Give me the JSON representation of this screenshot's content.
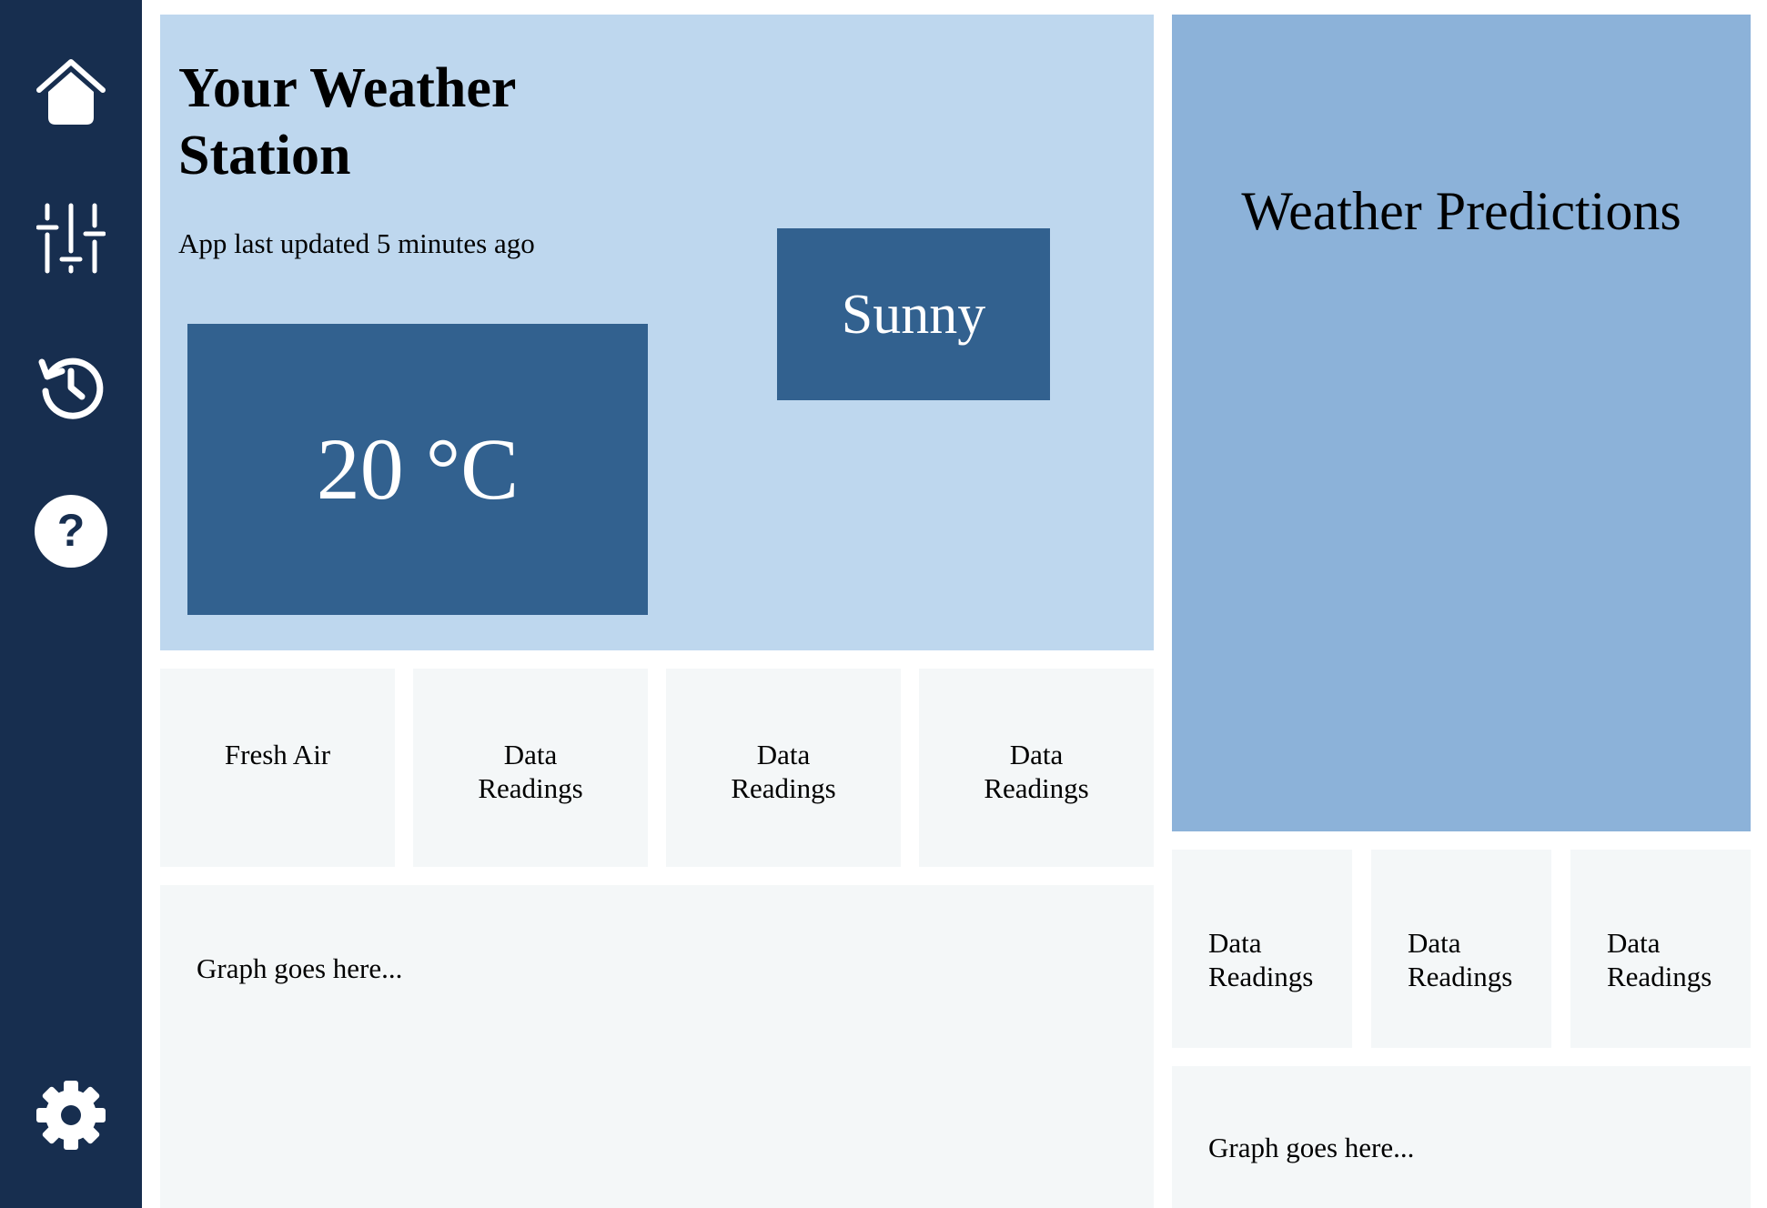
{
  "sidebar": {
    "items": [
      {
        "icon": "home-icon",
        "label": "Home"
      },
      {
        "icon": "sliders-icon",
        "label": "Controls"
      },
      {
        "icon": "history-icon",
        "label": "History"
      },
      {
        "icon": "help-icon",
        "label": "Help"
      }
    ],
    "settings": {
      "icon": "gear-icon",
      "label": "Settings"
    }
  },
  "station": {
    "title": "Your Weather Station",
    "updated": "App last updated 5 minutes ago",
    "temperature": "20 °C",
    "condition": "Sunny"
  },
  "predictions": {
    "title": "Weather Predictions"
  },
  "tiles_main": [
    {
      "label": "Fresh Air"
    },
    {
      "label": "Data Readings"
    },
    {
      "label": "Data Readings"
    },
    {
      "label": "Data Readings"
    }
  ],
  "tiles_side": [
    {
      "label": "Data Readings"
    },
    {
      "label": "Data Readings"
    },
    {
      "label": "Data Readings"
    }
  ],
  "graph_main": {
    "placeholder": "Graph goes here..."
  },
  "graph_side": {
    "placeholder": "Graph goes here..."
  },
  "colors": {
    "sidebar": "#172e4f",
    "station_panel": "#bed7ee",
    "predictions_panel": "#8cb2d9",
    "accent_box": "#32618f",
    "tile": "#f4f7f8"
  }
}
